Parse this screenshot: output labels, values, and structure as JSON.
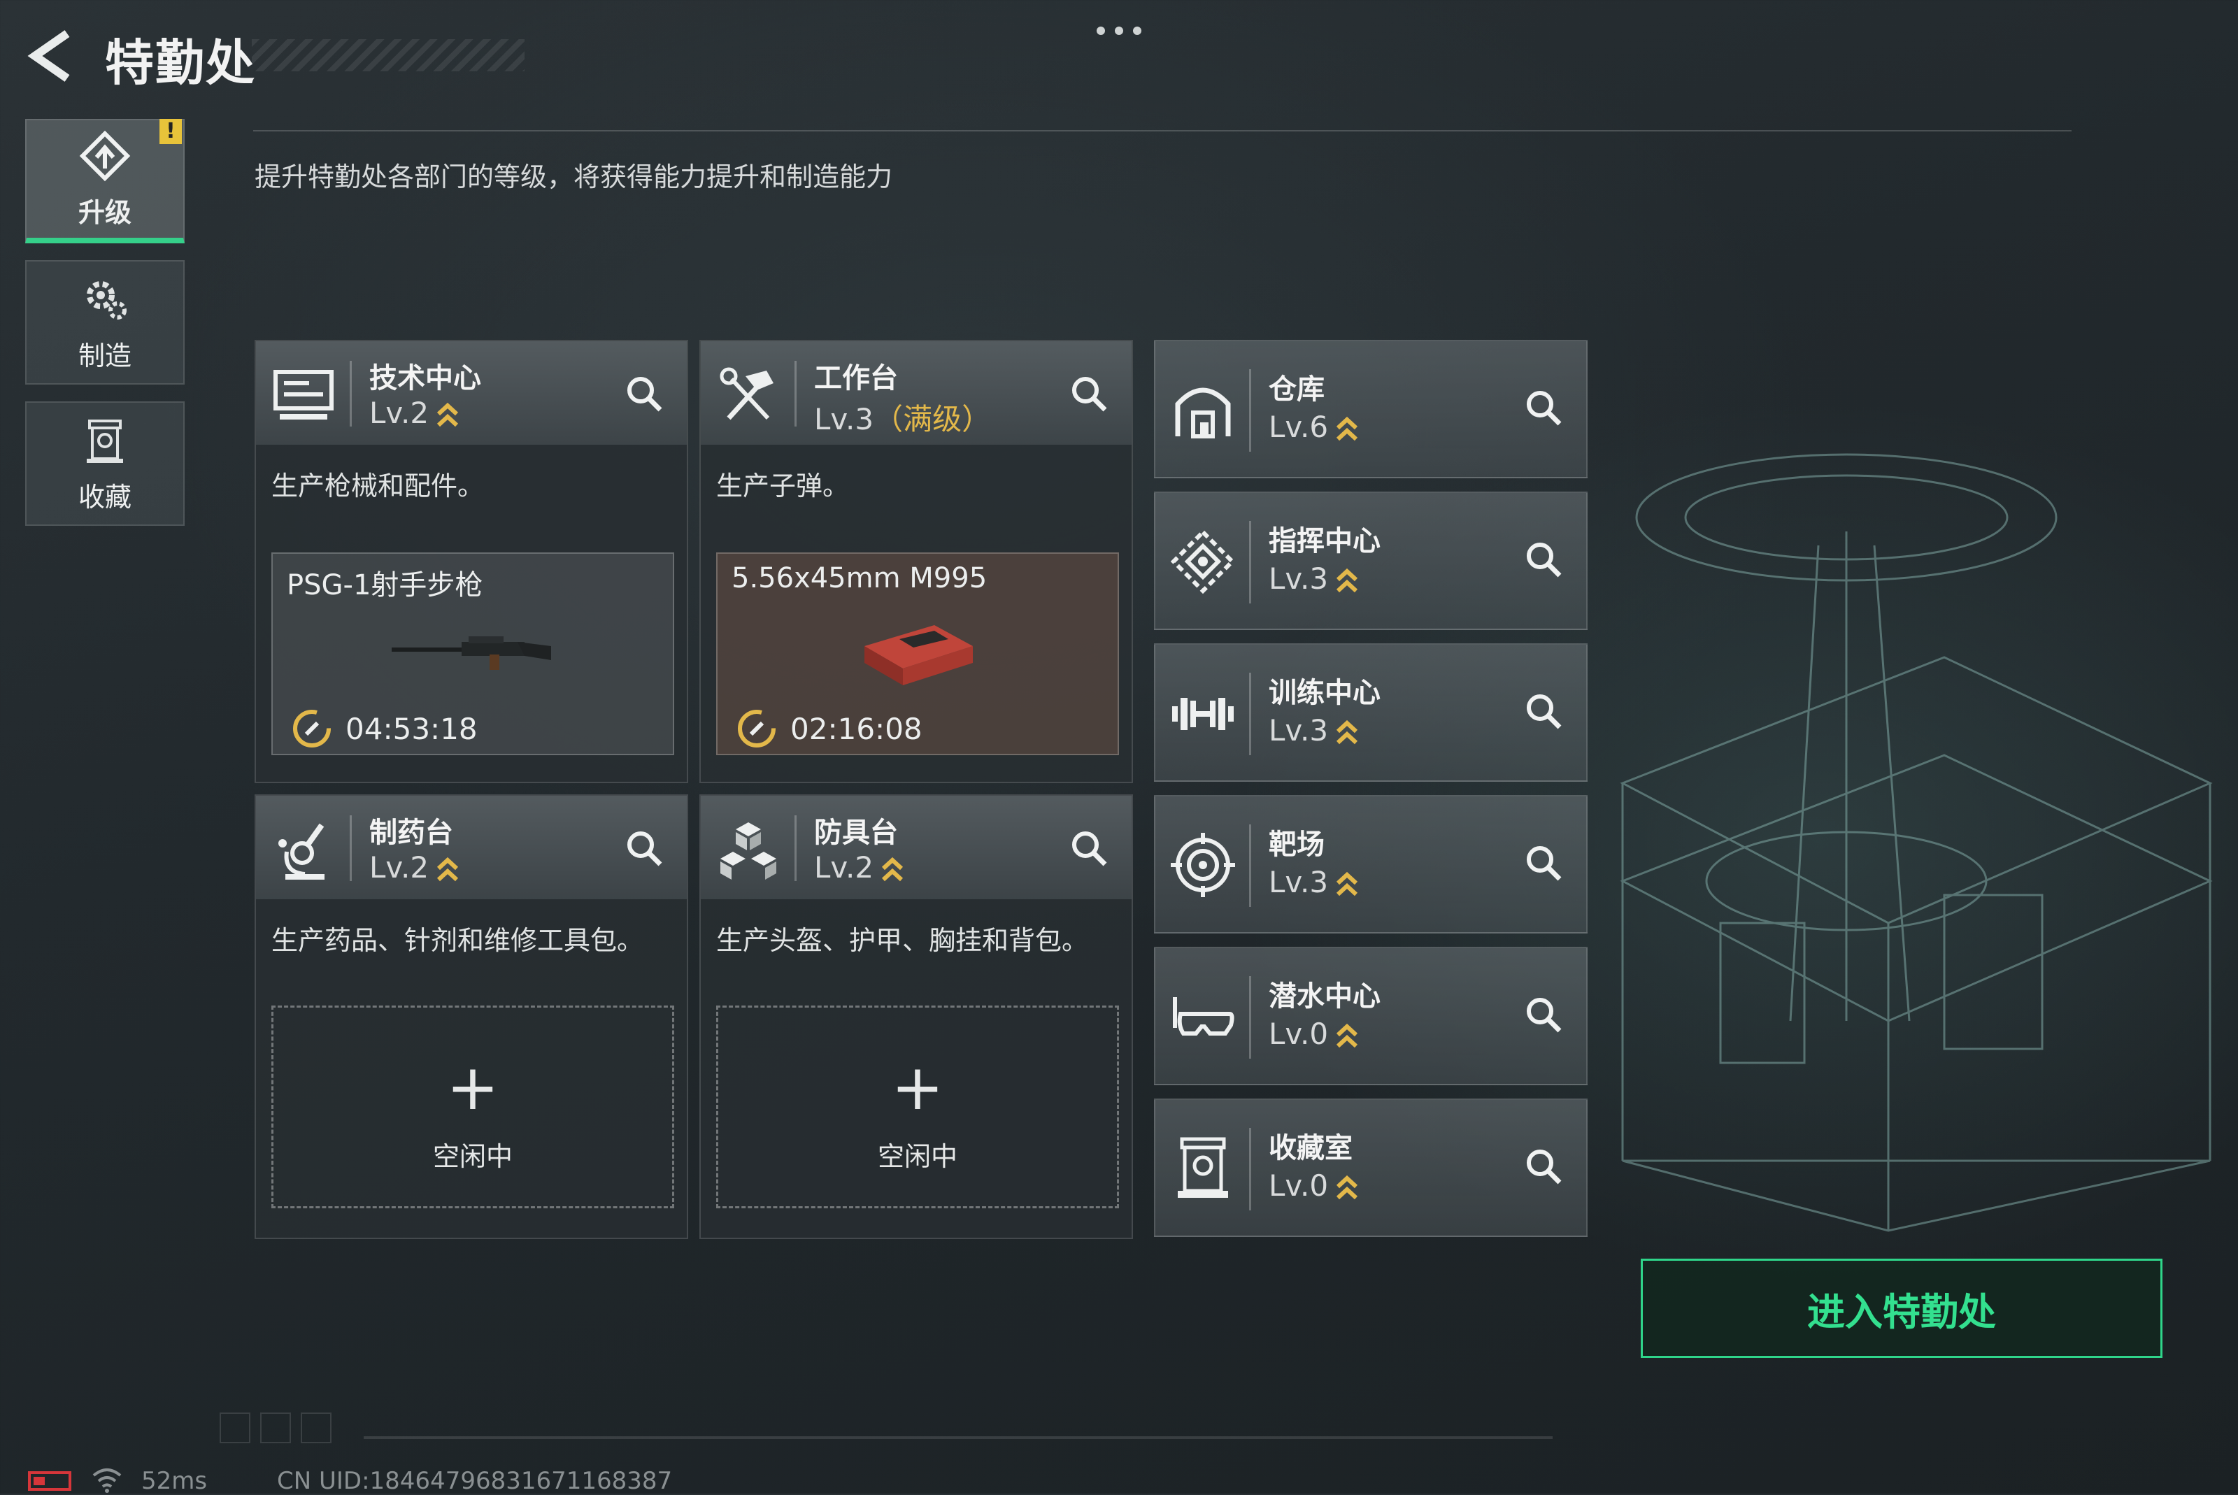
{
  "header": {
    "title": "特勤处",
    "back_icon": "back-arrow-icon",
    "more_icon": "more-dots-icon"
  },
  "subtitle": "提升特勤处各部门的等级，将获得能力提升和制造能力",
  "sidebar": {
    "items": [
      {
        "label": "升级",
        "icon": "upgrade-icon",
        "active": true,
        "badge": "!"
      },
      {
        "label": "制造",
        "icon": "gear-icon",
        "active": false
      },
      {
        "label": "收藏",
        "icon": "collection-icon",
        "active": false
      }
    ]
  },
  "production_cards": [
    {
      "name": "技术中心",
      "level": "Lv.2",
      "desc": "生产枪械和配件。",
      "icon": "monitor-icon",
      "product": {
        "name": "PSG-1射手步枪",
        "timer": "04:53:18",
        "item_icon": "rifle-icon"
      }
    },
    {
      "name": "工作台",
      "level": "Lv.3",
      "level_note": "（满级）",
      "desc": "生产子弹。",
      "icon": "hammer-icon",
      "product": {
        "name": "5.56x45mm M995",
        "timer": "02:16:08",
        "item_icon": "ammo-box-icon"
      }
    },
    {
      "name": "制药台",
      "level": "Lv.2",
      "desc": "生产药品、针剂和维修工具包。",
      "icon": "microscope-icon",
      "idle": {
        "plus": "+",
        "label": "空闲中"
      }
    },
    {
      "name": "防具台",
      "level": "Lv.2",
      "desc": "生产头盔、护甲、胸挂和背包。",
      "icon": "armor-blocks-icon",
      "idle": {
        "plus": "+",
        "label": "空闲中"
      }
    }
  ],
  "facility_list": [
    {
      "name": "仓库",
      "level": "Lv.6",
      "icon": "warehouse-icon"
    },
    {
      "name": "指挥中心",
      "level": "Lv.3",
      "icon": "command-icon"
    },
    {
      "name": "训练中心",
      "level": "Lv.3",
      "icon": "dumbbell-icon"
    },
    {
      "name": "靶场",
      "level": "Lv.3",
      "icon": "target-icon"
    },
    {
      "name": "潜水中心",
      "level": "Lv.0",
      "icon": "diving-mask-icon"
    },
    {
      "name": "收藏室",
      "level": "Lv.0",
      "icon": "collection-room-icon"
    }
  ],
  "enter_button": "进入特勤处",
  "status": {
    "ping": "52ms",
    "uid": "CN UID:18464796831671168387",
    "battery_color": "#d6363a"
  },
  "colors": {
    "accent": "#33e08f",
    "level_chevron": "#e3b84a",
    "max_level": "#e3b84a"
  }
}
